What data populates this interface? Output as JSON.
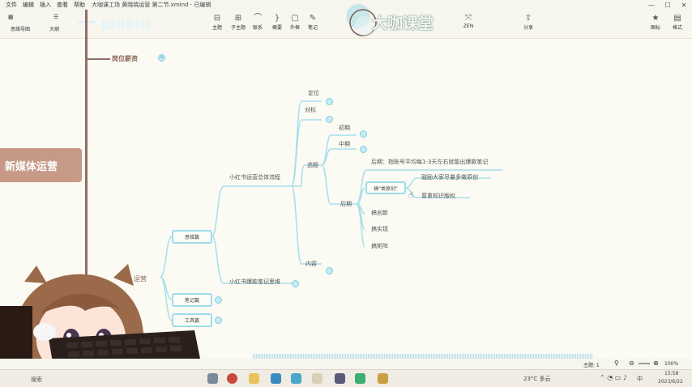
{
  "menu": {
    "items": [
      "文件",
      "编辑",
      "插入",
      "查看",
      "帮助"
    ],
    "doc_title": "大咖课工场 黄晓晓运营 第二节.xmind - 已编辑"
  },
  "toolbar": {
    "left_buttons": [
      "思维导图",
      "大纲"
    ],
    "tools": [
      {
        "label": "主题",
        "icon": "topic-icon"
      },
      {
        "label": "子主题",
        "icon": "subtopic-icon"
      },
      {
        "label": "联系",
        "icon": "relation-icon"
      },
      {
        "label": "概要",
        "icon": "summary-icon"
      },
      {
        "label": "外框",
        "icon": "boundary-icon"
      },
      {
        "label": "笔记",
        "icon": "note-icon"
      },
      {
        "label": "ZEN",
        "icon": "zen-icon"
      },
      {
        "label": "分享",
        "icon": "share-icon"
      },
      {
        "label": "图标",
        "icon": "star-icon"
      },
      {
        "label": "格式",
        "icon": "format-icon"
      }
    ],
    "bili_watermark": "bilibili",
    "logo_text": "大咖课堂"
  },
  "canvas": {
    "section_header": "岗位薪资",
    "main_topic": "新媒体运营",
    "partial_topic": "运营",
    "nodes": {
      "dingwei": "定位",
      "duibiao": "对标",
      "xuanti": "选题",
      "neirong": "内容",
      "chuqi": "初期",
      "zhongqi": "中期",
      "houqi_label": "后期",
      "houqi_text": "后期：指账号平均每1-3天左右就能出爆款笔记",
      "jia_yuanchuang": "搞\"类原创\"",
      "guli": "鼓励大家尽量多做原创",
      "zunzhong": "尊重知识版权",
      "gao_chuangxin": "搞创新",
      "gao_shixian": "搞实现",
      "gao_bianfu": "搞矩阵",
      "xhs_process": "小红书运营总体流程",
      "xhs_notes": "小红书爆款笔记思维",
      "siwei": "思维篇",
      "biji": "笔记篇",
      "gongju": "工具篇"
    }
  },
  "status": {
    "topics": "主题: 1",
    "zoom": "100%"
  },
  "taskbar": {
    "search": "搜索",
    "weather": "23°C 多云",
    "time": "15:58",
    "date": "2023/6/22",
    "ime": "中"
  },
  "colors": {
    "accent": "#9fdcea",
    "main_card": "#c69a87",
    "header_text": "#8f6a5f",
    "trunk": "#8f6f63"
  }
}
